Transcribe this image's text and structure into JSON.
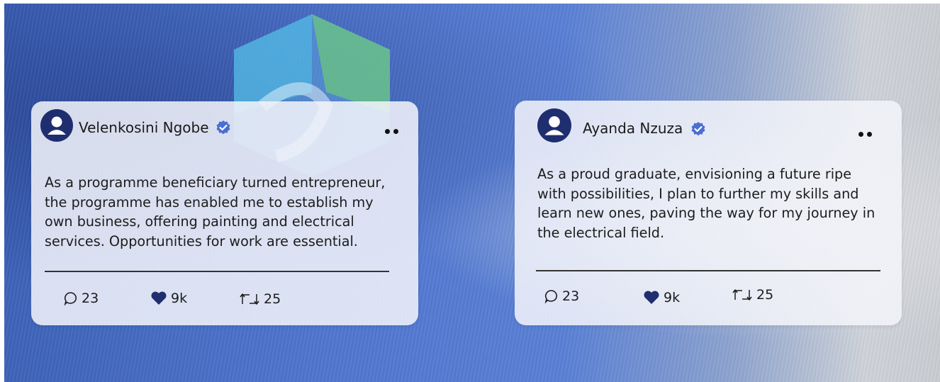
{
  "posts": [
    {
      "author": "Velenkosini Ngobe",
      "text": "As a programme beneficiary turned entrepreneur,\nthe programme has enabled me to establish my\nown business, offering painting and electrical\nservices. Opportunities for work are essential.",
      "comments": "23",
      "likes": "9k",
      "reposts": "25"
    },
    {
      "author": "Ayanda Nzuza",
      "text": "As a proud graduate, envisioning a future ripe\nwith possibilities, I plan to further my skills and\nlearn new ones, paving the way for my journey in\nthe electrical field.",
      "comments": "23",
      "likes": "9k",
      "reposts": "25"
    }
  ],
  "icons": {
    "avatar": "user-avatar-icon",
    "verified": "verified-badge-icon",
    "more": "more-options-icon",
    "comment": "comment-icon",
    "like": "heart-icon",
    "repost": "repost-icon"
  },
  "colors": {
    "accent": "#1f2e6e",
    "verified": "#4b6ed1",
    "card": "#f3f4fa"
  }
}
